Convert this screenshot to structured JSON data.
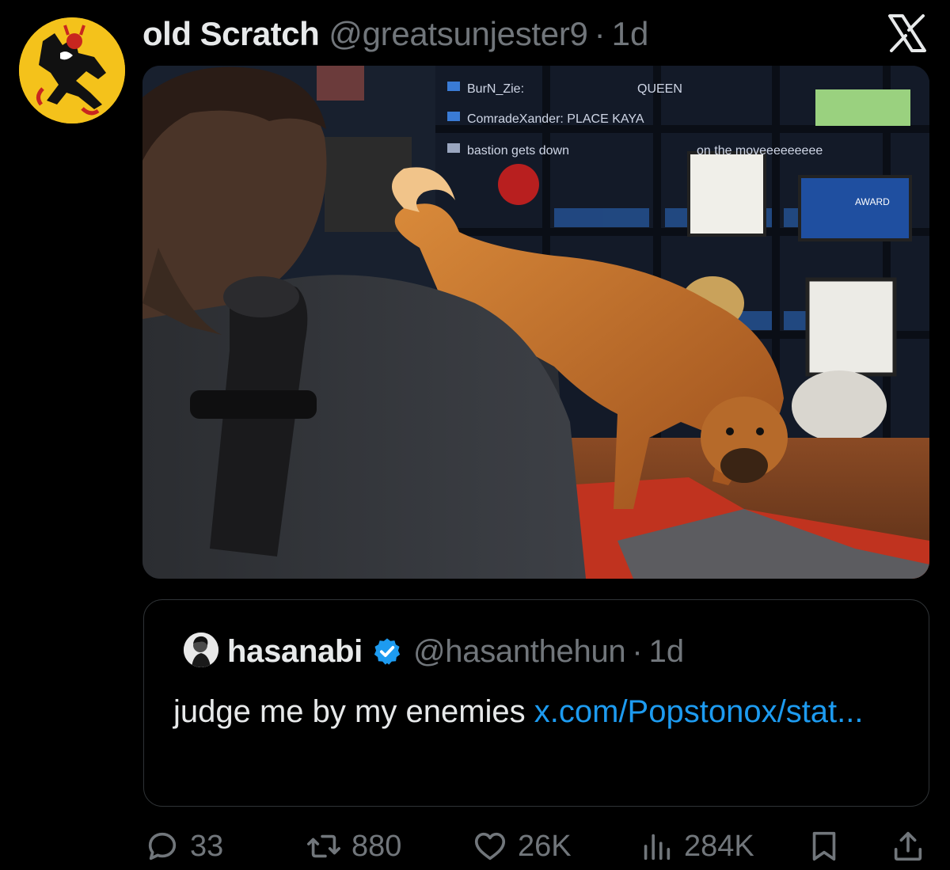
{
  "tweet": {
    "display_name": "old Scratch",
    "handle": "@greatsunjester9",
    "separator": "·",
    "time": "1d",
    "avatar_icon": "devil-avatar-icon",
    "close_icon": "x-logo-icon"
  },
  "media": {
    "overlay_lines": [
      "BurN_Zie:",
      "QUEEN",
      "ComradeXander: PLACE KAYA",
      "bastion gets down",
      "on the moveeeeeeeee",
      "AWARD"
    ]
  },
  "quote": {
    "display_name": "hasanabi",
    "verified_icon": "verified-badge-icon",
    "handle": "@hasanthehun",
    "separator": "·",
    "time": "1d",
    "text": "judge me by my enemies ",
    "link_text": "x.com/Popstonox/​stat..."
  },
  "actions": {
    "replies": "33",
    "reposts": "880",
    "likes": "26K",
    "views": "284K"
  },
  "colors": {
    "background": "#000000",
    "text_primary": "#e7e9ea",
    "text_secondary": "#71767b",
    "link": "#1d9bf0",
    "border": "#2f3336"
  }
}
